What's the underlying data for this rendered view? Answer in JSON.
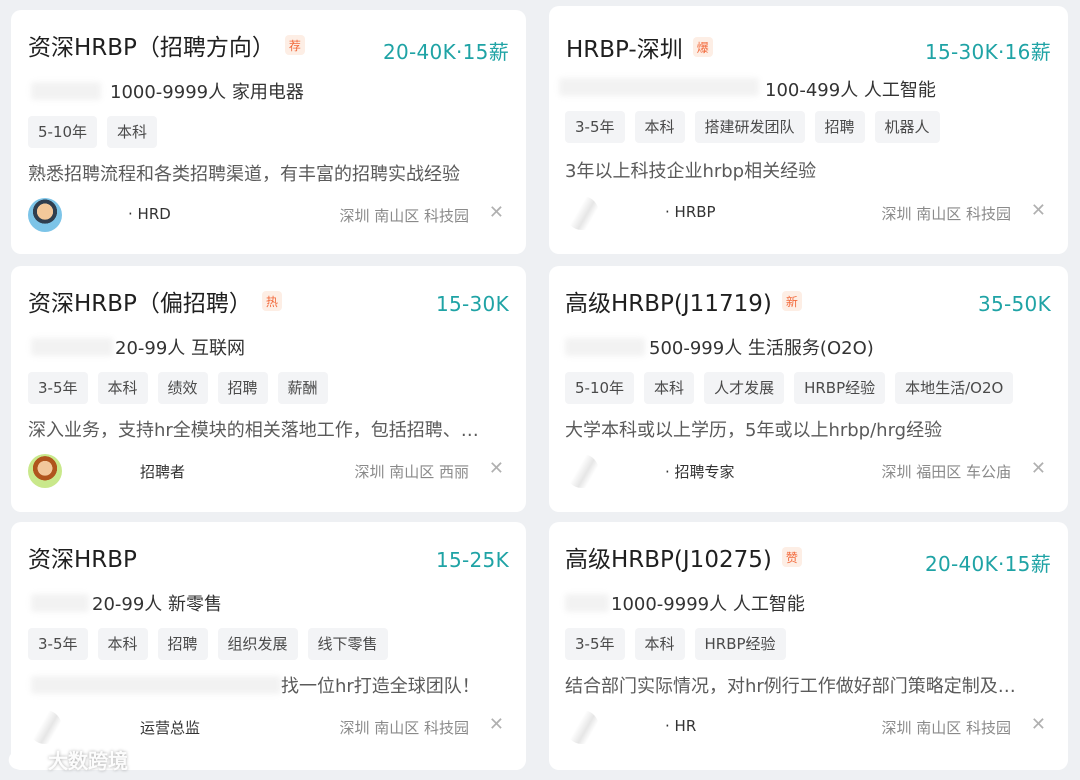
{
  "colors": {
    "salary": "#1fa3a5",
    "badge": "#f26a3c",
    "background": "#eef0f3"
  },
  "jobs": [
    {
      "title": "资深HRBP（招聘方向）",
      "badge": "荐",
      "salary": "20-40K·15薪",
      "company": "1000-9999人 家用电器",
      "tags": [
        "5-10年",
        "本科"
      ],
      "desc": "熟悉招聘流程和各类招聘渠道，有丰富的招聘实战经验",
      "poster": "· HRD",
      "location": "深圳 南山区 科技园",
      "avatar": "person-avatar-icon"
    },
    {
      "title": "HRBP-深圳",
      "badge": "爆",
      "salary": "15-30K·16薪",
      "company": "100-499人 人工智能",
      "tags": [
        "3-5年",
        "本科",
        "搭建研发团队",
        "招聘",
        "机器人"
      ],
      "desc": "3年以上科技企业hrbp相关经验",
      "poster": "· HRBP",
      "location": "深圳 南山区 科技园",
      "avatar": "blurred-avatar-icon"
    },
    {
      "title": "资深HRBP（偏招聘）",
      "badge": "热",
      "salary": "15-30K",
      "company": "20-99人 互联网",
      "tags": [
        "3-5年",
        "本科",
        "绩效",
        "招聘",
        "薪酬"
      ],
      "desc": "深入业务，支持hr全模块的相关落地工作，包括招聘、…",
      "poster": "招聘者",
      "location": "深圳 南山区 西丽",
      "avatar": "person-avatar-icon"
    },
    {
      "title": "高级HRBP(J11719)",
      "badge": "新",
      "salary": "35-50K",
      "company": "500-999人 生活服务(O2O)",
      "tags": [
        "5-10年",
        "本科",
        "人才发展",
        "HRBP经验",
        "本地生活/O2O"
      ],
      "desc": "大学本科或以上学历，5年或以上hrbp/hrg经验",
      "poster": "· 招聘专家",
      "location": "深圳 福田区 车公庙",
      "avatar": "blurred-avatar-icon"
    },
    {
      "title": "资深HRBP",
      "badge": "",
      "salary": "15-25K",
      "company": "20-99人 新零售",
      "tags": [
        "3-5年",
        "本科",
        "招聘",
        "组织发展",
        "线下零售"
      ],
      "desc": "找一位hr打造全球团队！",
      "poster": "运营总监",
      "location": "深圳 南山区 科技园",
      "avatar": "blurred-avatar-icon"
    },
    {
      "title": "高级HRBP(J10275)",
      "badge": "赞",
      "salary": "20-40K·15薪",
      "company": "1000-9999人 人工智能",
      "tags": [
        "3-5年",
        "本科",
        "HRBP经验"
      ],
      "desc": "结合部门实际情况，对hr例行工作做好部门策略定制及…",
      "poster": "· HR",
      "location": "深圳 南山区 科技园",
      "avatar": "blurred-avatar-icon"
    }
  ],
  "watermark": {
    "text": "大数跨境"
  }
}
